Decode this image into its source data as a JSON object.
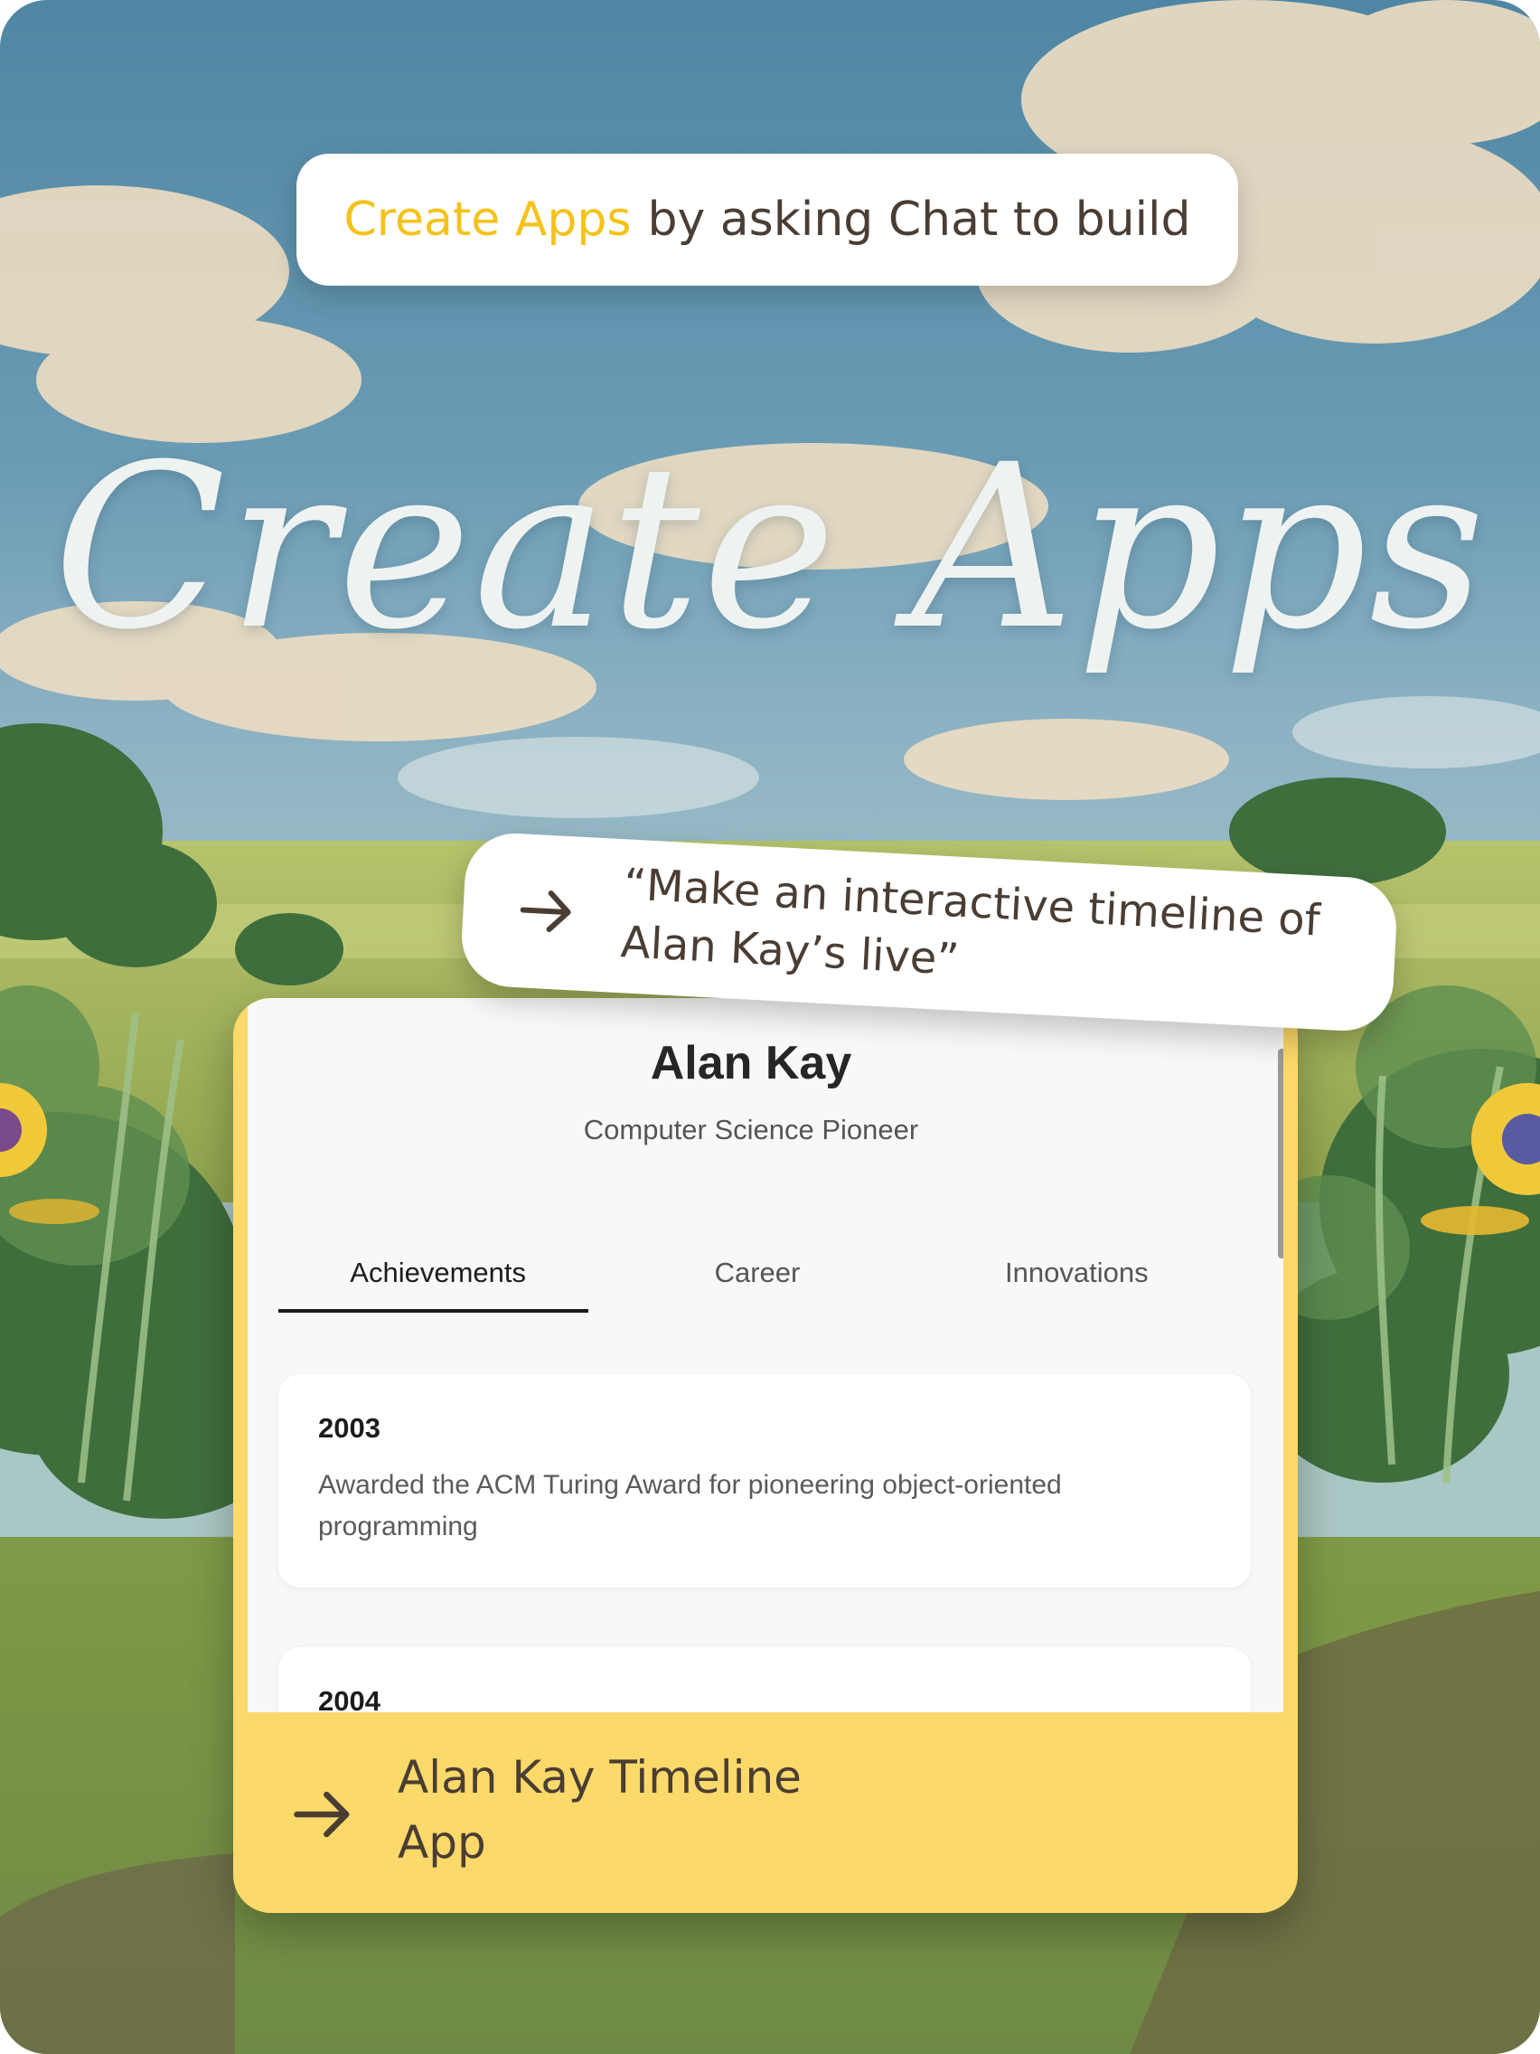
{
  "headline": {
    "highlight": "Create Apps",
    "rest": "by asking Chat to build"
  },
  "hero_title": "Create Apps",
  "prompt": {
    "text": "“Make an interactive timeline of Alan Kay’s live”",
    "icon": "arrow-right-icon"
  },
  "app": {
    "name": "Alan Kay",
    "subtitle": "Computer Science Pioneer",
    "tabs": [
      {
        "label": "Achievements",
        "active": true
      },
      {
        "label": "Career",
        "active": false
      },
      {
        "label": "Innovations",
        "active": false
      }
    ],
    "entries": [
      {
        "year": "2003",
        "description": "Awarded the ACM Turing Award for pioneering object-oriented programming"
      },
      {
        "year": "2004",
        "description": ""
      }
    ]
  },
  "footer": {
    "label": "Alan Kay Timeline App",
    "icon": "arrow-right-icon"
  },
  "colors": {
    "accent_yellow": "#fbd96a",
    "highlight_text": "#f5c21a",
    "brown_text": "#4a3d33"
  }
}
